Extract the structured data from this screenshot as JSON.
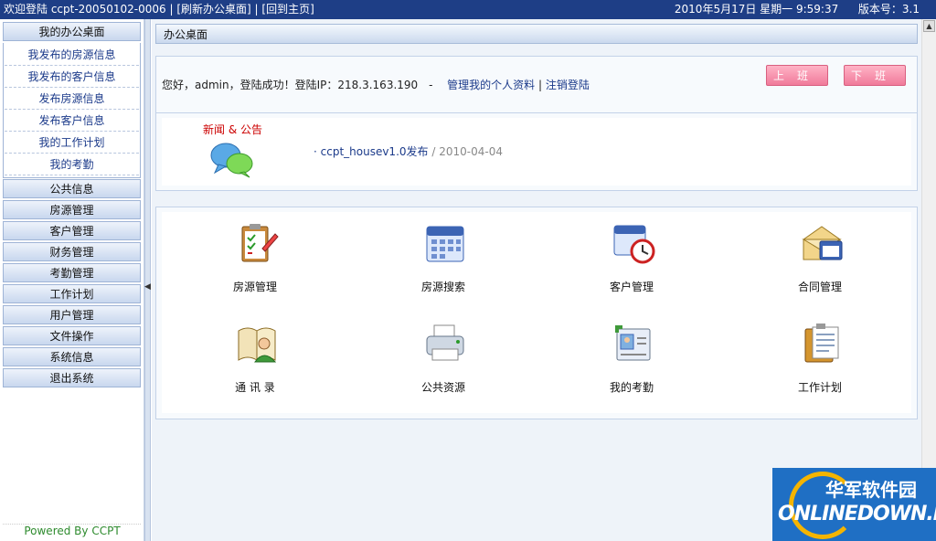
{
  "topbar": {
    "welcome": "欢迎登陆 ccpt-20050102-0006",
    "refresh_link": "[刷新办公桌面]",
    "home_link": "[回到主页]",
    "datetime": "2010年5月17日 星期一 9:59:37",
    "version": "版本号：3.1"
  },
  "sidebar": {
    "header": "我的办公桌面",
    "sub_items": [
      "我发布的房源信息",
      "我发布的客户信息",
      "发布房源信息",
      "发布客户信息",
      "我的工作计划",
      "我的考勤"
    ],
    "categories": [
      "公共信息",
      "房源管理",
      "客户管理",
      "财务管理",
      "考勤管理",
      "工作计划",
      "用户管理",
      "文件操作",
      "系统信息",
      "退出系统"
    ],
    "powered": "Powered By CCPT"
  },
  "main": {
    "header": "办公桌面",
    "welcome": {
      "greeting": "您好，admin，登陆成功！登陆IP：218.3.163.190　-",
      "profile_link": "管理我的个人资料",
      "logout_link": "注销登陆",
      "on_duty": "上班",
      "off_duty": "下班"
    },
    "news": {
      "title": "新闻 & 公告",
      "item_title": "· ccpt_housev1.0发布",
      "separator": "/",
      "item_date": "2010-04-04"
    },
    "apps": [
      {
        "label": "房源管理",
        "icon": "clipboard-icon"
      },
      {
        "label": "房源搜索",
        "icon": "calendar-icon"
      },
      {
        "label": "客户管理",
        "icon": "calendar-clock-icon"
      },
      {
        "label": "合同管理",
        "icon": "envelope-window-icon"
      },
      {
        "label": "通 讯 录",
        "icon": "address-book-icon"
      },
      {
        "label": "公共资源",
        "icon": "printer-icon"
      },
      {
        "label": "我的考勤",
        "icon": "id-card-icon"
      },
      {
        "label": "工作计划",
        "icon": "notepad-icon"
      }
    ]
  },
  "watermark": {
    "cn": "华军软件园",
    "en": "ONLINEDOWN.NET"
  }
}
